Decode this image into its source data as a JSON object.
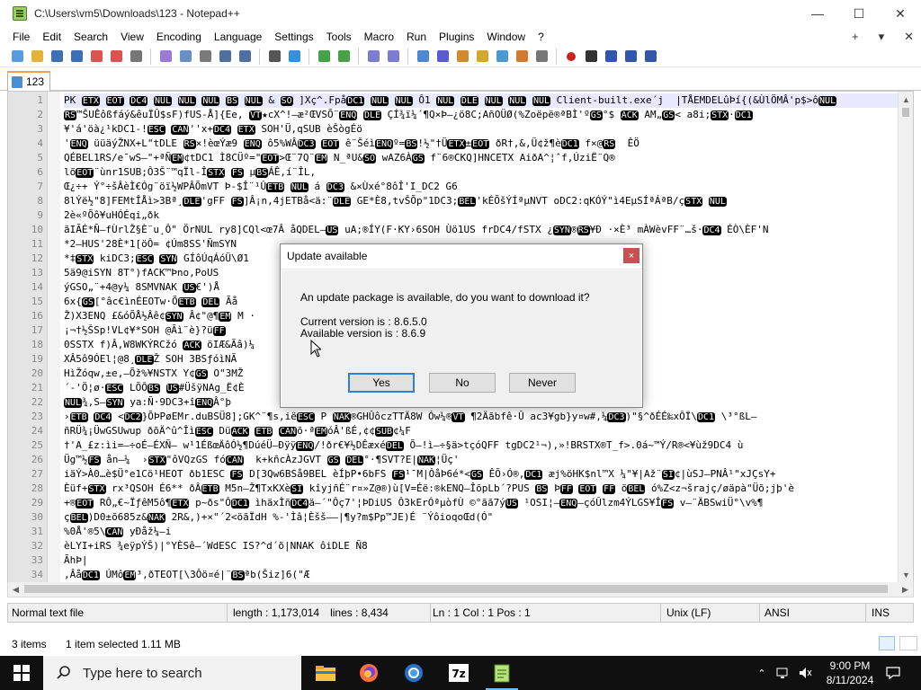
{
  "window": {
    "title": "C:\\Users\\vm5\\Downloads\\123 - Notepad++",
    "minimize_glyph": "—",
    "maximize_glyph": "☐",
    "close_glyph": "✕"
  },
  "menu": {
    "items": [
      "File",
      "Edit",
      "Search",
      "View",
      "Encoding",
      "Language",
      "Settings",
      "Tools",
      "Macro",
      "Run",
      "Plugins",
      "Window",
      "?"
    ],
    "right_plus": "+",
    "right_dropdown": "▾",
    "right_close": "✕"
  },
  "toolbar_icons": [
    "new-file-icon",
    "open-file-icon",
    "save-icon",
    "save-all-icon",
    "close-icon",
    "close-all-icon",
    "print-icon",
    "cut-icon",
    "copy-icon",
    "paste-icon",
    "undo-icon",
    "redo-icon",
    "find-icon",
    "replace-icon",
    "zoom-in-icon",
    "zoom-out-icon",
    "sync-vertical-icon",
    "sync-horizontal-icon",
    "word-wrap-icon",
    "show-all-chars-icon",
    "indent-guide-icon",
    "doc-map-icon",
    "function-list-icon",
    "folder-workspace-icon",
    "monitoring-icon",
    "record-macro-icon",
    "stop-record-icon",
    "play-macro-icon",
    "run-macro-multiple-icon",
    "save-macro-icon"
  ],
  "tab": {
    "label": "123"
  },
  "editor": {
    "line_numbers": [
      "1",
      "2",
      "3",
      "4",
      "5",
      "6",
      "7",
      "8",
      "9",
      "10",
      "11",
      "12",
      "13",
      "14",
      "15",
      "16",
      "17",
      "18",
      "19",
      "20",
      "21",
      "22",
      "23",
      "24",
      "25",
      "26",
      "27",
      "28",
      "29",
      "30",
      "31",
      "32",
      "33",
      "34"
    ],
    "lines": [
      "PK ETX EOT DC4 NUL NUL NUL BS NUL & SO ]Xç^.FpåDC1 NUL NUL Ô1 NUL DLE NUL NUL NUL Client-built.exe´j  |TÅEMDELûÞí{(&ÙlÖMÂ'p$>ôNUL",
      "RS™ŠUÊôßfáý&êuÏÛ$sF)fUS-Å]{Ee, VT★cX^!–æ²ŒVSÕ¨ENQ DLE ÇÍ¾ï¼´¶Q×Þ–¿ö8C;AñOÜØ(%Zoëpë®ªBÌ'ºGS°$ ACK AM„GS< a8i;STX·DC1",
      "¥'á'öà¿¹kDC1-!ESC CAN''x+DC4 ETX SOH'Ü,qSUB èŠògÉö",
      "'ENQ üüäýŽNX+L\"tDLE RS×!èœÝæ9 ENQ ô5%WÂDC3 EOT ê¨ŠéìENQº=BS!½\"†ÜETX±EOT ðR†,&,Ü¢ž¶èDC1 f×@RS  ÊÖ",
      "QÉBEL1RS/e¯wS–\"+ªÑEM¢tDC1 Ì8CÜº=\"EOT>Œ¨7Q¨EM N_ªU&SO wAZ6ÀGS f¨6®CKQ]HNCETX AiðA^¦ˆf‚ÚziË¨Q®",
      "lõEOT¨ùnr1SUB;Ô3Š¨™qÏl-ÎSTX FS µBSÁÊ,í¨ÎL,",
      "Œ¿÷+ Ý°÷šÂèÌ€Óg¨öï½WPÂÕmVT Þ-$Î¨¹ÛETB NUL á DC3 &×Ùxé°8ôÎ'I_DC2 G6",
      "8lÝë½\"8]FEMtÎÅì>3Bª¸DLE'gFF FS]Â¡n,4jETBå<ä:¨DLE GE*È8,tvŠÕp\"1DC3;BEL'kÉÕšÝÍªµNVT oDC2:qKÓÝ\"ì4EµSÍªÁªB/çSTX NUL",
      "2è«ºÕô¥uHÓÉqi„ðk",
      "ãIÃÉ*Ñ–fÙrlŽ§È¨u¸Ô\" ÖrNUL ry8]CQl<œ7Â åQDEL–US uA;®ÍY(F·KY›6SOH Ùö1US frDC4/fSTX ¿SYN®RS¥Ð ·×È³ mÀWèvFF¨…š·DC4 ÉÒ\\ÈF'N",
      "*2–HUS'28È*1[öÔ= ¢Úm8SS'ÑmSYN",
      "*‡STX kiDC3;ESC SYN GÍôÚqÁóÜ\\Ø1",
      "5ä9@iSYN 8T°)fACK™Þno,PoUS",
      "ýGSO„¨+4@y¼ 8SMVNAK US€')Å",
      "6x{GS[°âc€ìnÉEOTw·ÕETB DEL Ãå",
      "Ž)X3ENQ £&óÕÅ½Âê¢SYN Â¢\"@¶EM M ·",
      "¡¬†½ŠSp!VL¢¥*SOH @Ãì¨è}?üFF",
      "0SSTX f)Â,W8WKÝRCžó ACK öIÆ&Ãâ)¼",
      "XÂ5ô9ÓEl¦@8¸DLEŽ SOH 3BSƒóìNÃ",
      "HìŽóqw,±e,–Õž%¥NSTX Y¢GS O\"3MŽ",
      "´-'Ö¦ø·ESC LÕÔBS US#ÜšÿNAg_Ë¢È",
      "NUL¾,S–SYN ya:Ñ·9DC3+îENQÂ°þ",
      "›ETB DC4 <DC2}ÕÞPøEMr.duBSÜ8];GK^¨¶s,iëESC P NAK®GHÛôczTTÄ8W Ów¼®VT ¶2Äãbfê·Û ac3¥gb}y¤w#,¼DC3)\"§^ðÉÉ‰xÔÏ\\DC1 \\³°ßL–",
      "ñRÜ¾¡ÜwGSUwup ðõÄ^û^ÎìESC DüACK ETB CANõ·ªEMóÂ'ßÉ,¢¢SUB¢¼F",
      "†'A_£z:ìi=–÷oÉ–ÉXÑ– w¹1ÉßœÄôÓ½¶DúéÜ–ÐÿÿENQ/!ðr€¥½DÊæxéDEL Õ–!ì–÷§ä>tçóQFF tgDC2¹¬),»!BRSTX®T_f>.0á~™Ý/R®<¥ùž9DC4 ù",
      "Üg™½FS ån–¼  ›STX\"ôVQzGS fóCAN  k+kñcÀzJGVT GS DEL°·¶SVT?E|NAK¦Üç'",
      "iäÝ>À0…è$Ü°e1Cö¹HEOT ðb1ESC FS D[3Qw6BSå9BEL èÍþP•6bFS FS¹¯M|ÔåÞ6é*<GS ÊÕ›Ó®,DC1 æj%öHK$nl™X ¼\"¥|Až¨SI¢|ùSJ–PNÂ¹\"xJÇsY+",
      "Èüf+STX rx³QSOH É6** ðÂETB M5n–Ž¶TxKXèSI kîyjñÉ¨r¤»Z@®)ù[V=Éë:®kENQ–ÎõpLb´?PUS BS ÞFF EOT FF õBEL ó%Z<z¬šrajç/øäpà\"Üõ;jþ'è",
      "+®EOT RÔ„€~ÏƒêM5ô¶ETX p~ðs\"ÔDC1 ìhäxÌñDC4ä–´\"Ôç7'¦ÞDiUS Ô3kErÓªµòfÙ ©°ãã7ýUS ¹OSI¦–ENQ–çóÛlzm4ÝLGS¥ÎFS v–¨ÄBSwiÜ°\\v%¶",
      "çBEL)D0±õ685z&NAK 2R&,)+×\"´2<öãÏdH %-'Ìâ¦Èšš––|¶y?m$Pp™JE)É ¨ÝôioqoŒd(Ó\"",
      "%0Å'®5\\CAN yÐåž¼–i",
      "èLYI+iRS ¾eÿpÝŠ)|°YÈSê–´WdESC IS?^d´õ|NNAK ôiDLE Ñ8",
      "ÃhÞ|",
      ",ÂåDC1 ÚMôEM³,ðTEOT[\\3Ôö¤é|¨BSªb(Šiz]6(\"Æ"
    ]
  },
  "status": {
    "type": "Normal text file",
    "length": "length : 1,173,014",
    "lines": "lines : 8,434",
    "position": "Ln : 1    Col : 1    Pos : 1",
    "eol": "Unix (LF)",
    "encoding": "ANSI",
    "mode": "INS"
  },
  "explorer": {
    "items": "3 items",
    "selected": "1 item selected  1.11 MB"
  },
  "taskbar": {
    "search_placeholder": "Type here to search",
    "apps": [
      "file-explorer-icon",
      "firefox-icon",
      "chrome-icon",
      "7zip-icon",
      "notepadpp-icon"
    ],
    "time": "9:00 PM",
    "date": "8/11/2024"
  },
  "dialog": {
    "title": "Update available",
    "message": "An update package is available, do you want to download it?",
    "current_version": "Current version is   : 8.6.5.0",
    "available_version": "Available version is : 8.6.9",
    "yes": "Yes",
    "no": "No",
    "never": "Never",
    "close_glyph": "×"
  },
  "colors": {
    "accent": "#2e7fd6",
    "tab_accent": "#f5a04a",
    "control_char_bg": "#000000",
    "taskbar": "#101010",
    "dialog_close": "#c75050"
  }
}
